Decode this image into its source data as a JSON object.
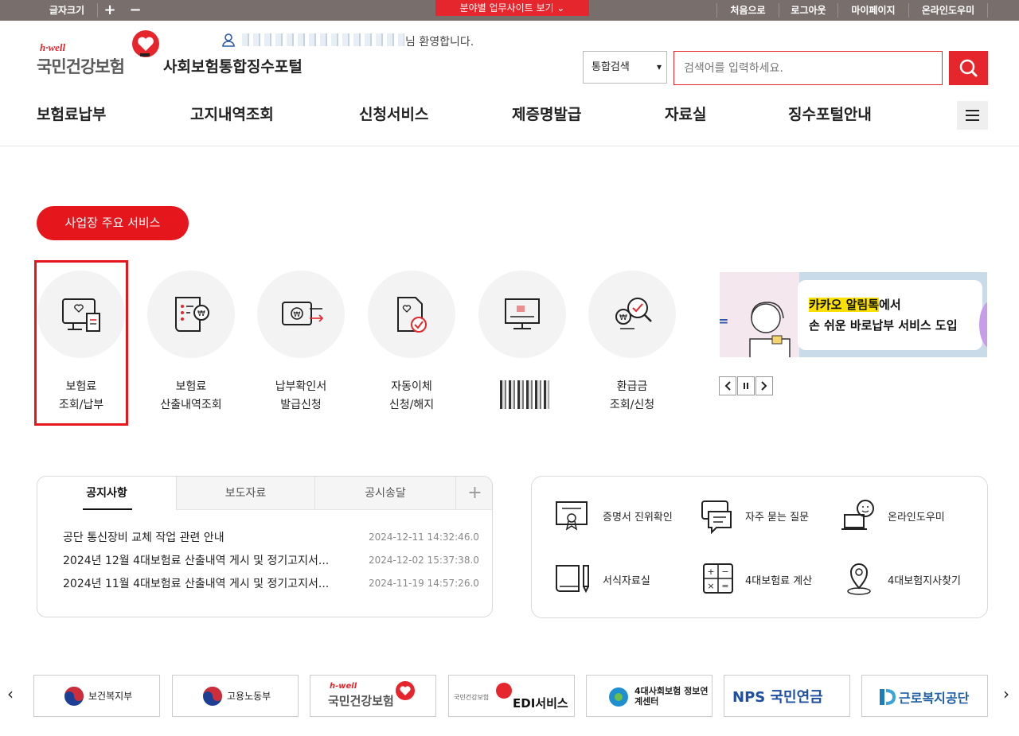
{
  "topbar": {
    "font_size_label": "글자크기",
    "font_plus": "+",
    "font_minus": "−",
    "sector_label": "분야별 업무사이트 보기",
    "links": [
      "처음으로",
      "로그아웃",
      "마이페이지",
      "온라인도우미"
    ]
  },
  "header": {
    "logo_hwell": "h·well",
    "logo_name": "국민건강보험",
    "portal_title": "사회보험통합징수포털",
    "welcome_suffix": "님 환영합니다.",
    "search_select": "통합검색",
    "search_placeholder": "검색어를 입력하세요."
  },
  "gnb": [
    "보험료납부",
    "고지내역조회",
    "신청서비스",
    "제증명발급",
    "자료실",
    "징수포털안내"
  ],
  "services": {
    "title": "사업장 주요 서비스",
    "items": [
      {
        "line1": "보험료",
        "line2": "조회/납부",
        "icon": "monitor-receipt-icon"
      },
      {
        "line1": "보험료",
        "line2": "산출내역조회",
        "icon": "bill-won-icon"
      },
      {
        "line1": "납부확인서",
        "line2": "발급신청",
        "icon": "certificate-transfer-icon"
      },
      {
        "line1": "자동이체",
        "line2": "신청/해지",
        "icon": "document-check-icon"
      },
      {
        "line1": "",
        "line2": "",
        "icon": "monitor-chart-icon"
      },
      {
        "line1": "환급금",
        "line2": "조회/신청",
        "icon": "refund-search-icon"
      }
    ]
  },
  "banner": {
    "line1_highlight": "카카오 알림톡",
    "line1_rest": "에서",
    "line2": "손 쉬운 바로납부 서비스 도입",
    "side_char": "="
  },
  "notice": {
    "tabs": [
      "공지사항",
      "보도자료",
      "공시송달"
    ],
    "more": "+",
    "rows": [
      {
        "title": "공단 통신장비 교체 작업 관련 안내",
        "date": "2024-12-11 14:32:46.0"
      },
      {
        "title": "2024년 12월 4대보험료 산출내역 게시 및 정기고지서...",
        "date": "2024-12-02 15:37:38.0"
      },
      {
        "title": "2024년 11월 4대보험료 산출내역 게시 및 정기고지서...",
        "date": "2024-11-19 14:57:26.0"
      }
    ]
  },
  "quicklinks": [
    {
      "label": "증명서 진위확인",
      "icon": "certificate-icon"
    },
    {
      "label": "자주 묻는 질문",
      "icon": "chat-bubble-icon"
    },
    {
      "label": "온라인도우미",
      "icon": "helper-laptop-icon"
    },
    {
      "label": "서식자료실",
      "icon": "book-pen-icon"
    },
    {
      "label": "4대보험료 계산",
      "icon": "calculator-icon"
    },
    {
      "label": "4대보험지사찾기",
      "icon": "location-pin-icon"
    }
  ],
  "family_sites": [
    {
      "name": "보건복지부"
    },
    {
      "name": "고용노동부"
    },
    {
      "name": "국민건강보험",
      "sub": "h-well"
    },
    {
      "name": "EDI서비스",
      "sub": "국민건강보험"
    },
    {
      "name": "4대사회보험 정보연계센터"
    },
    {
      "name": "NPS 국민연금"
    },
    {
      "name": "근로복지공단"
    }
  ],
  "colors": {
    "accent": "#e5272d",
    "topbar": "#786e6c"
  }
}
